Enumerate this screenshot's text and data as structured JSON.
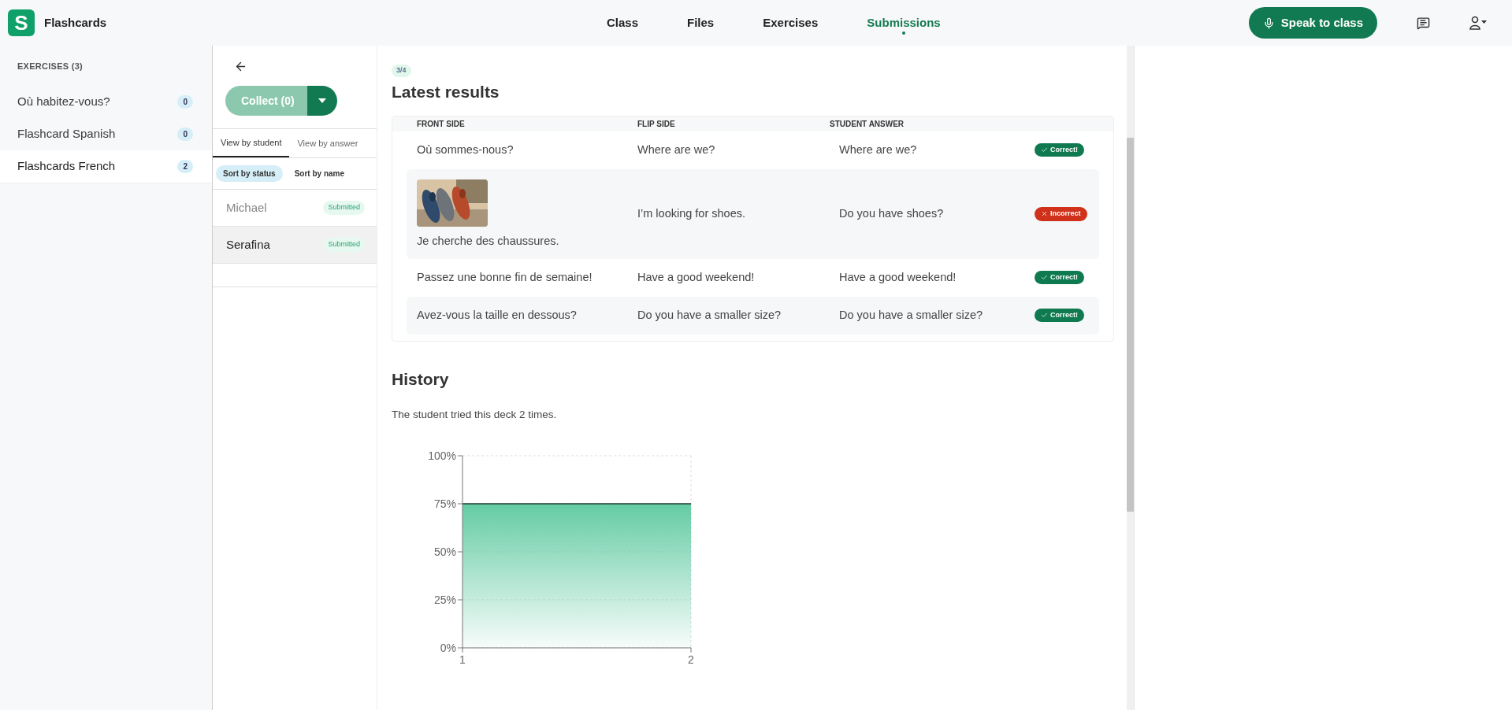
{
  "app": {
    "logo_letter": "S",
    "title": "Flashcards"
  },
  "nav": [
    {
      "label": "Class",
      "selected": false
    },
    {
      "label": "Files",
      "selected": false
    },
    {
      "label": "Exercises",
      "selected": false
    },
    {
      "label": "Submissions",
      "selected": true
    }
  ],
  "speak_button": "Speak to class",
  "sidebar": {
    "heading": "EXERCISES (3)",
    "items": [
      {
        "label": "Où habitez-vous?",
        "count": "0",
        "selected": false
      },
      {
        "label": "Flashcard Spanish",
        "count": "0",
        "selected": false
      },
      {
        "label": "Flashcards French",
        "count": "2",
        "selected": true
      }
    ]
  },
  "students_panel": {
    "collect_button": "Collect (0)",
    "view_tabs": [
      {
        "label": "View by student",
        "selected": true
      },
      {
        "label": "View by answer",
        "selected": false
      }
    ],
    "sort_tabs": [
      {
        "label": "Sort by status",
        "selected": true
      },
      {
        "label": "Sort by name",
        "selected": false
      }
    ],
    "students": [
      {
        "name": "Michael",
        "status": "Submitted",
        "selected": false
      },
      {
        "name": "Serafina",
        "status": "Submitted",
        "selected": true
      }
    ]
  },
  "results": {
    "score": "3/4",
    "title": "Latest results",
    "columns": [
      "FRONT SIDE",
      "FLIP SIDE",
      "STUDENT ANSWER"
    ],
    "rows": [
      {
        "kind": "text",
        "front": "Où sommes-nous?",
        "flip": "Where are we?",
        "answer": "Where are we?",
        "result": {
          "kind": "correct",
          "label": "Correct!"
        }
      },
      {
        "kind": "picture",
        "front": "Je cherche des chaussures.",
        "flip": "I’m looking for shoes.",
        "answer": "Do you have shoes?",
        "result": {
          "kind": "incorrect",
          "label": "Incorrect"
        }
      },
      {
        "kind": "text",
        "front": "Passez une bonne fin de semaine!",
        "flip": "Have a good weekend!",
        "answer": "Have a good weekend!",
        "result": {
          "kind": "correct",
          "label": "Correct!"
        }
      },
      {
        "kind": "text",
        "front": "Avez-vous la taille en dessous?",
        "flip": "Do you have a smaller size?",
        "answer": "Do you have a smaller size?",
        "result": {
          "kind": "correct",
          "label": "Correct!"
        }
      }
    ]
  },
  "history": {
    "title": "History",
    "text": "The student tried this deck 2 times.",
    "chart_data": {
      "type": "area",
      "x": [
        1,
        2
      ],
      "xticks": [
        1,
        2
      ],
      "xlim": [
        1,
        2
      ],
      "ylim": [
        0,
        100
      ],
      "yticks": [
        {
          "value": 0,
          "label": "0%"
        },
        {
          "value": 25,
          "label": "25%"
        },
        {
          "value": 50,
          "label": "50%"
        },
        {
          "value": 75,
          "label": "75%"
        },
        {
          "value": 100,
          "label": "100%"
        }
      ],
      "series": [
        {
          "color": "#5cc9a0",
          "values": [
            75,
            75
          ]
        }
      ]
    }
  }
}
